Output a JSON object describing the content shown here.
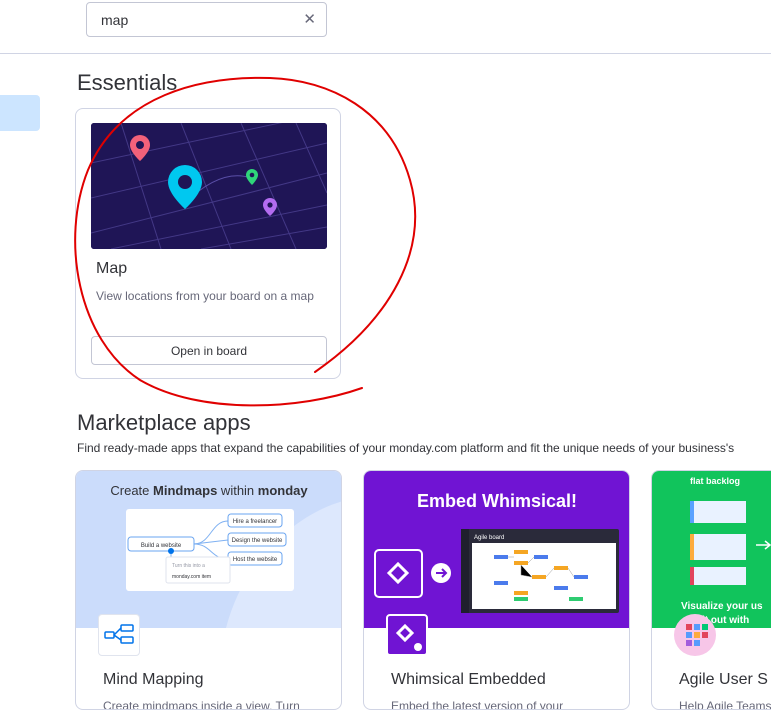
{
  "search": {
    "value": "map",
    "clear_glyph": "✕"
  },
  "sections": {
    "essentials": "Essentials",
    "marketplace": "Marketplace apps",
    "marketplace_sub": "Find ready-made apps that expand the capabilities of your monday.com platform and fit the unique needs of your business's"
  },
  "essentials_card": {
    "title": "Map",
    "description": "View locations from your board on a map",
    "button": "Open in board"
  },
  "apps": [
    {
      "name": "Mind Mapping",
      "desc": "Create mindmaps inside a view. Turn",
      "banner": {
        "title_plain1": "Create ",
        "title_bold1": "Mindmaps",
        "title_plain2": " within ",
        "title_bold2": "monday",
        "nodes": [
          "Build a website",
          "Hire a freelancer",
          "Design the website",
          "Host the website",
          "Turn this into a",
          "monday.com item"
        ]
      }
    },
    {
      "name": "Whimsical Embedded",
      "desc": "Embed the latest version of your",
      "banner": {
        "title": "Embed Whimsical!",
        "board_label": "Agile board"
      }
    },
    {
      "name": "Agile User S",
      "desc": "Help Agile Teams",
      "banner": {
        "title": "flat backlog",
        "footer1": "Visualize your us",
        "footer2": "it out with"
      }
    }
  ],
  "colors": {
    "mind_bg": "#cbdcfb",
    "whim_bg": "#7014d3",
    "agile_bg": "#11c45c",
    "map_bg": "#1f1556",
    "annotation": "#e00000"
  }
}
